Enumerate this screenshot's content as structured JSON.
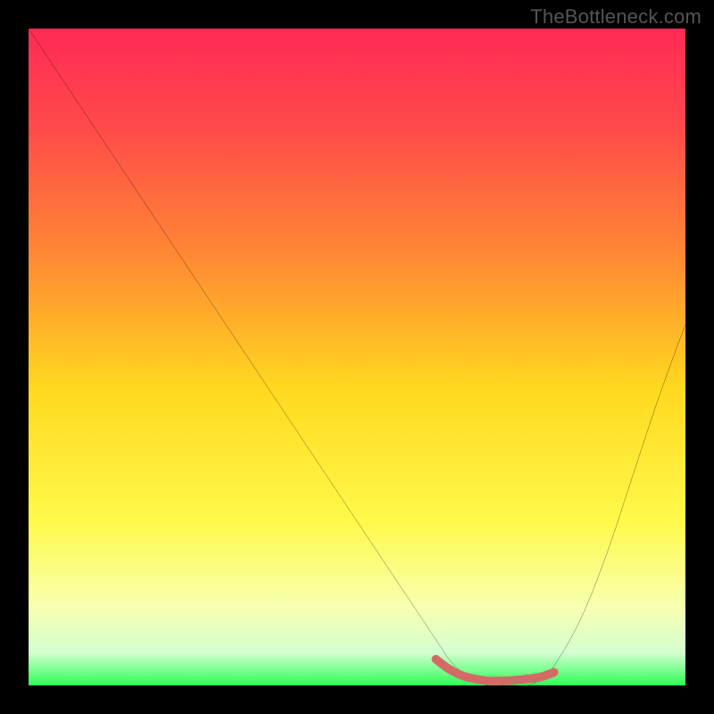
{
  "watermark": {
    "text": "TheBottleneck.com"
  },
  "chart_data": {
    "type": "line",
    "title": "",
    "xlabel": "",
    "ylabel": "",
    "xlim": [
      0,
      100
    ],
    "ylim": [
      0,
      100
    ],
    "background_gradient": {
      "stops": [
        {
          "offset": 0.0,
          "color": "#ff2a55"
        },
        {
          "offset": 0.15,
          "color": "#ff4a4a"
        },
        {
          "offset": 0.35,
          "color": "#ff8a33"
        },
        {
          "offset": 0.55,
          "color": "#ffd91f"
        },
        {
          "offset": 0.75,
          "color": "#fff94a"
        },
        {
          "offset": 0.88,
          "color": "#f8ffb0"
        },
        {
          "offset": 0.95,
          "color": "#d4ffd0"
        },
        {
          "offset": 1.0,
          "color": "#2dff55"
        }
      ]
    },
    "series": [
      {
        "name": "bottleneck-curve",
        "color": "#000000",
        "width": 2,
        "x": [
          0,
          4,
          8,
          12,
          16,
          20,
          24,
          28,
          32,
          36,
          40,
          44,
          48,
          52,
          56,
          60,
          62,
          64,
          66,
          68,
          70,
          72,
          74,
          76,
          78,
          80,
          84,
          88,
          92,
          96,
          100
        ],
        "y": [
          100,
          94,
          88,
          82,
          76,
          70,
          64,
          58,
          52,
          46,
          40,
          34,
          28,
          22,
          16,
          10,
          7,
          4,
          2,
          1,
          0,
          0,
          0,
          0,
          1,
          3,
          10,
          20,
          32,
          44,
          55
        ]
      }
    ],
    "highlight_segment": {
      "name": "flat-minimum",
      "color": "#d46a66",
      "x": [
        62,
        64,
        66,
        68,
        70,
        72,
        74,
        76,
        78,
        80
      ],
      "y": [
        4,
        2.5,
        1.5,
        1,
        0.7,
        0.7,
        0.8,
        1,
        1.3,
        2
      ]
    }
  }
}
